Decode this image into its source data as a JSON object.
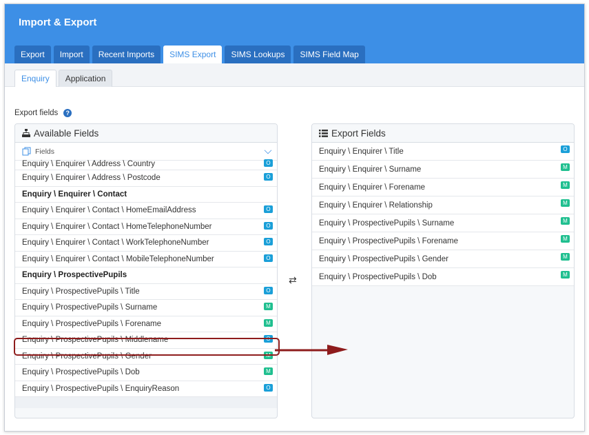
{
  "app": {
    "title": "Import & Export"
  },
  "main_tabs": [
    {
      "label": "Export",
      "active": false
    },
    {
      "label": "Import",
      "active": false
    },
    {
      "label": "Recent Imports",
      "active": false
    },
    {
      "label": "SIMS Export",
      "active": true
    },
    {
      "label": "SIMS Lookups",
      "active": false
    },
    {
      "label": "SIMS Field Map",
      "active": false
    }
  ],
  "sub_tabs": [
    {
      "label": "Enquiry",
      "active": true
    },
    {
      "label": "Application",
      "active": false
    }
  ],
  "export_fields_label": "Export fields",
  "help_glyph": "?",
  "available": {
    "title": "Available Fields",
    "dropdown_label": "Fields",
    "rows": [
      {
        "label": "Enquiry \\ Enquirer \\ Address \\ Country",
        "badge": "O",
        "group": false
      },
      {
        "label": "Enquiry \\ Enquirer \\ Address \\ Postcode",
        "badge": "O",
        "group": false
      },
      {
        "label": "Enquiry \\ Enquirer \\ Contact",
        "badge": "",
        "group": true
      },
      {
        "label": "Enquiry \\ Enquirer \\ Contact \\ HomeEmailAddress",
        "badge": "O",
        "group": false
      },
      {
        "label": "Enquiry \\ Enquirer \\ Contact \\ HomeTelephoneNumber",
        "badge": "O",
        "group": false
      },
      {
        "label": "Enquiry \\ Enquirer \\ Contact \\ WorkTelephoneNumber",
        "badge": "O",
        "group": false
      },
      {
        "label": "Enquiry \\ Enquirer \\ Contact \\ MobileTelephoneNumber",
        "badge": "O",
        "group": false
      },
      {
        "label": "Enquiry \\ ProspectivePupils",
        "badge": "",
        "group": true
      },
      {
        "label": "Enquiry \\ ProspectivePupils \\ Title",
        "badge": "O",
        "group": false
      },
      {
        "label": "Enquiry \\ ProspectivePupils \\ Surname",
        "badge": "M",
        "group": false
      },
      {
        "label": "Enquiry \\ ProspectivePupils \\ Forename",
        "badge": "M",
        "group": false
      },
      {
        "label": "Enquiry \\ ProspectivePupils \\ Middlename",
        "badge": "O",
        "group": false
      },
      {
        "label": "Enquiry \\ ProspectivePupils \\ Gender",
        "badge": "M",
        "group": false
      },
      {
        "label": "Enquiry \\ ProspectivePupils \\ Dob",
        "badge": "M",
        "group": false
      },
      {
        "label": "Enquiry \\ ProspectivePupils \\ EnquiryReason",
        "badge": "O",
        "group": false
      }
    ]
  },
  "export": {
    "title": "Export Fields",
    "rows": [
      {
        "label": "Enquiry \\ Enquirer \\ Title",
        "badge": "O"
      },
      {
        "label": "Enquiry \\ Enquirer \\ Surname",
        "badge": "M"
      },
      {
        "label": "Enquiry \\ Enquirer \\ Forename",
        "badge": "M"
      },
      {
        "label": "Enquiry \\ Enquirer \\ Relationship",
        "badge": "M"
      },
      {
        "label": "Enquiry \\ ProspectivePupils \\ Surname",
        "badge": "M"
      },
      {
        "label": "Enquiry \\ ProspectivePupils \\ Forename",
        "badge": "M"
      },
      {
        "label": "Enquiry \\ ProspectivePupils \\ Gender",
        "badge": "M"
      },
      {
        "label": "Enquiry \\ ProspectivePupils \\ Dob",
        "badge": "M"
      }
    ]
  },
  "swap_glyph": "⇄",
  "colors": {
    "header": "#3d8fe6",
    "badge_optional": "#1a9fd8",
    "badge_mandatory": "#1fbf8f",
    "annotation": "#8e1c1c"
  }
}
